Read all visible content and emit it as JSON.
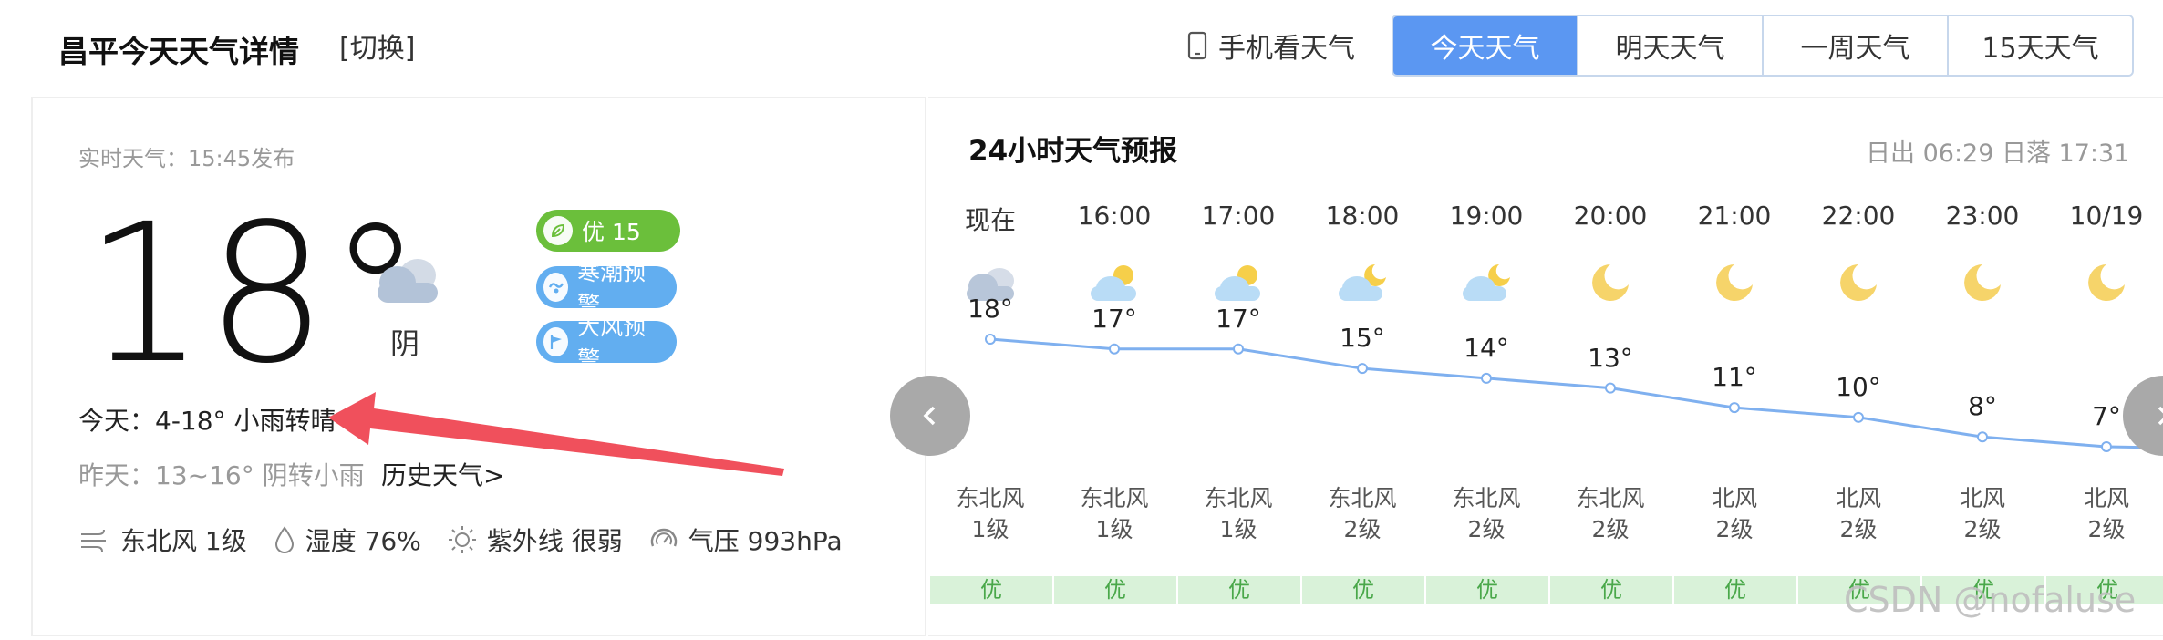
{
  "header": {
    "title": "昌平今天天气详情",
    "switch": "[切换]",
    "mobile": "手机看天气",
    "tabs": [
      "今天天气",
      "明天天气",
      "一周天气",
      "15天天气"
    ]
  },
  "current": {
    "published": "实时天气：15:45发布",
    "temp": "18°",
    "condition": "阴",
    "icon": "cloudy-icon",
    "aqi_label": "优 15",
    "warning_cold": "寒潮预警",
    "warning_wind": "大风预警",
    "today": "今天：4-18° 小雨转晴",
    "yesterday": "昨天：13~16° 阴转小雨",
    "history_link": "历史天气>",
    "wind": "东北风 1级",
    "humidity": "湿度 76%",
    "uv": "紫外线 很弱",
    "pressure": "气压 993hPa"
  },
  "forecast": {
    "title": "24小时天气预报",
    "sun": "日出 06:29 日落 17:31",
    "hours": [
      {
        "time": "现在",
        "icon": "cloudy-icon",
        "temp": "18°",
        "t": 18,
        "wind_dir": "东北风",
        "wind_level": "1级",
        "aqi": "优"
      },
      {
        "time": "16:00",
        "icon": "partly-cloudy-day-icon",
        "temp": "17°",
        "t": 17,
        "wind_dir": "东北风",
        "wind_level": "1级",
        "aqi": "优"
      },
      {
        "time": "17:00",
        "icon": "partly-cloudy-day-icon",
        "temp": "17°",
        "t": 17,
        "wind_dir": "东北风",
        "wind_level": "1级",
        "aqi": "优"
      },
      {
        "time": "18:00",
        "icon": "partly-cloudy-night-icon",
        "temp": "15°",
        "t": 15,
        "wind_dir": "东北风",
        "wind_level": "2级",
        "aqi": "优"
      },
      {
        "time": "19:00",
        "icon": "partly-cloudy-night-icon",
        "temp": "14°",
        "t": 14,
        "wind_dir": "东北风",
        "wind_level": "2级",
        "aqi": "优"
      },
      {
        "time": "20:00",
        "icon": "moon-icon",
        "temp": "13°",
        "t": 13,
        "wind_dir": "东北风",
        "wind_level": "2级",
        "aqi": "优"
      },
      {
        "time": "21:00",
        "icon": "moon-icon",
        "temp": "11°",
        "t": 11,
        "wind_dir": "北风",
        "wind_level": "2级",
        "aqi": "优"
      },
      {
        "time": "22:00",
        "icon": "moon-icon",
        "temp": "10°",
        "t": 10,
        "wind_dir": "北风",
        "wind_level": "2级",
        "aqi": "优"
      },
      {
        "time": "23:00",
        "icon": "moon-icon",
        "temp": "8°",
        "t": 8,
        "wind_dir": "北风",
        "wind_level": "2级",
        "aqi": "优"
      },
      {
        "time": "10/19",
        "icon": "moon-icon",
        "temp": "7°",
        "t": 7,
        "wind_dir": "北风",
        "wind_level": "2级",
        "aqi": "优"
      }
    ]
  },
  "watermark": "CSDN @nofaluse",
  "colors": {
    "accent": "#5b97f2",
    "good": "#6bbf3b",
    "warn": "#62aef0",
    "line": "#7fb0ef",
    "arrow": "#f0505c"
  }
}
